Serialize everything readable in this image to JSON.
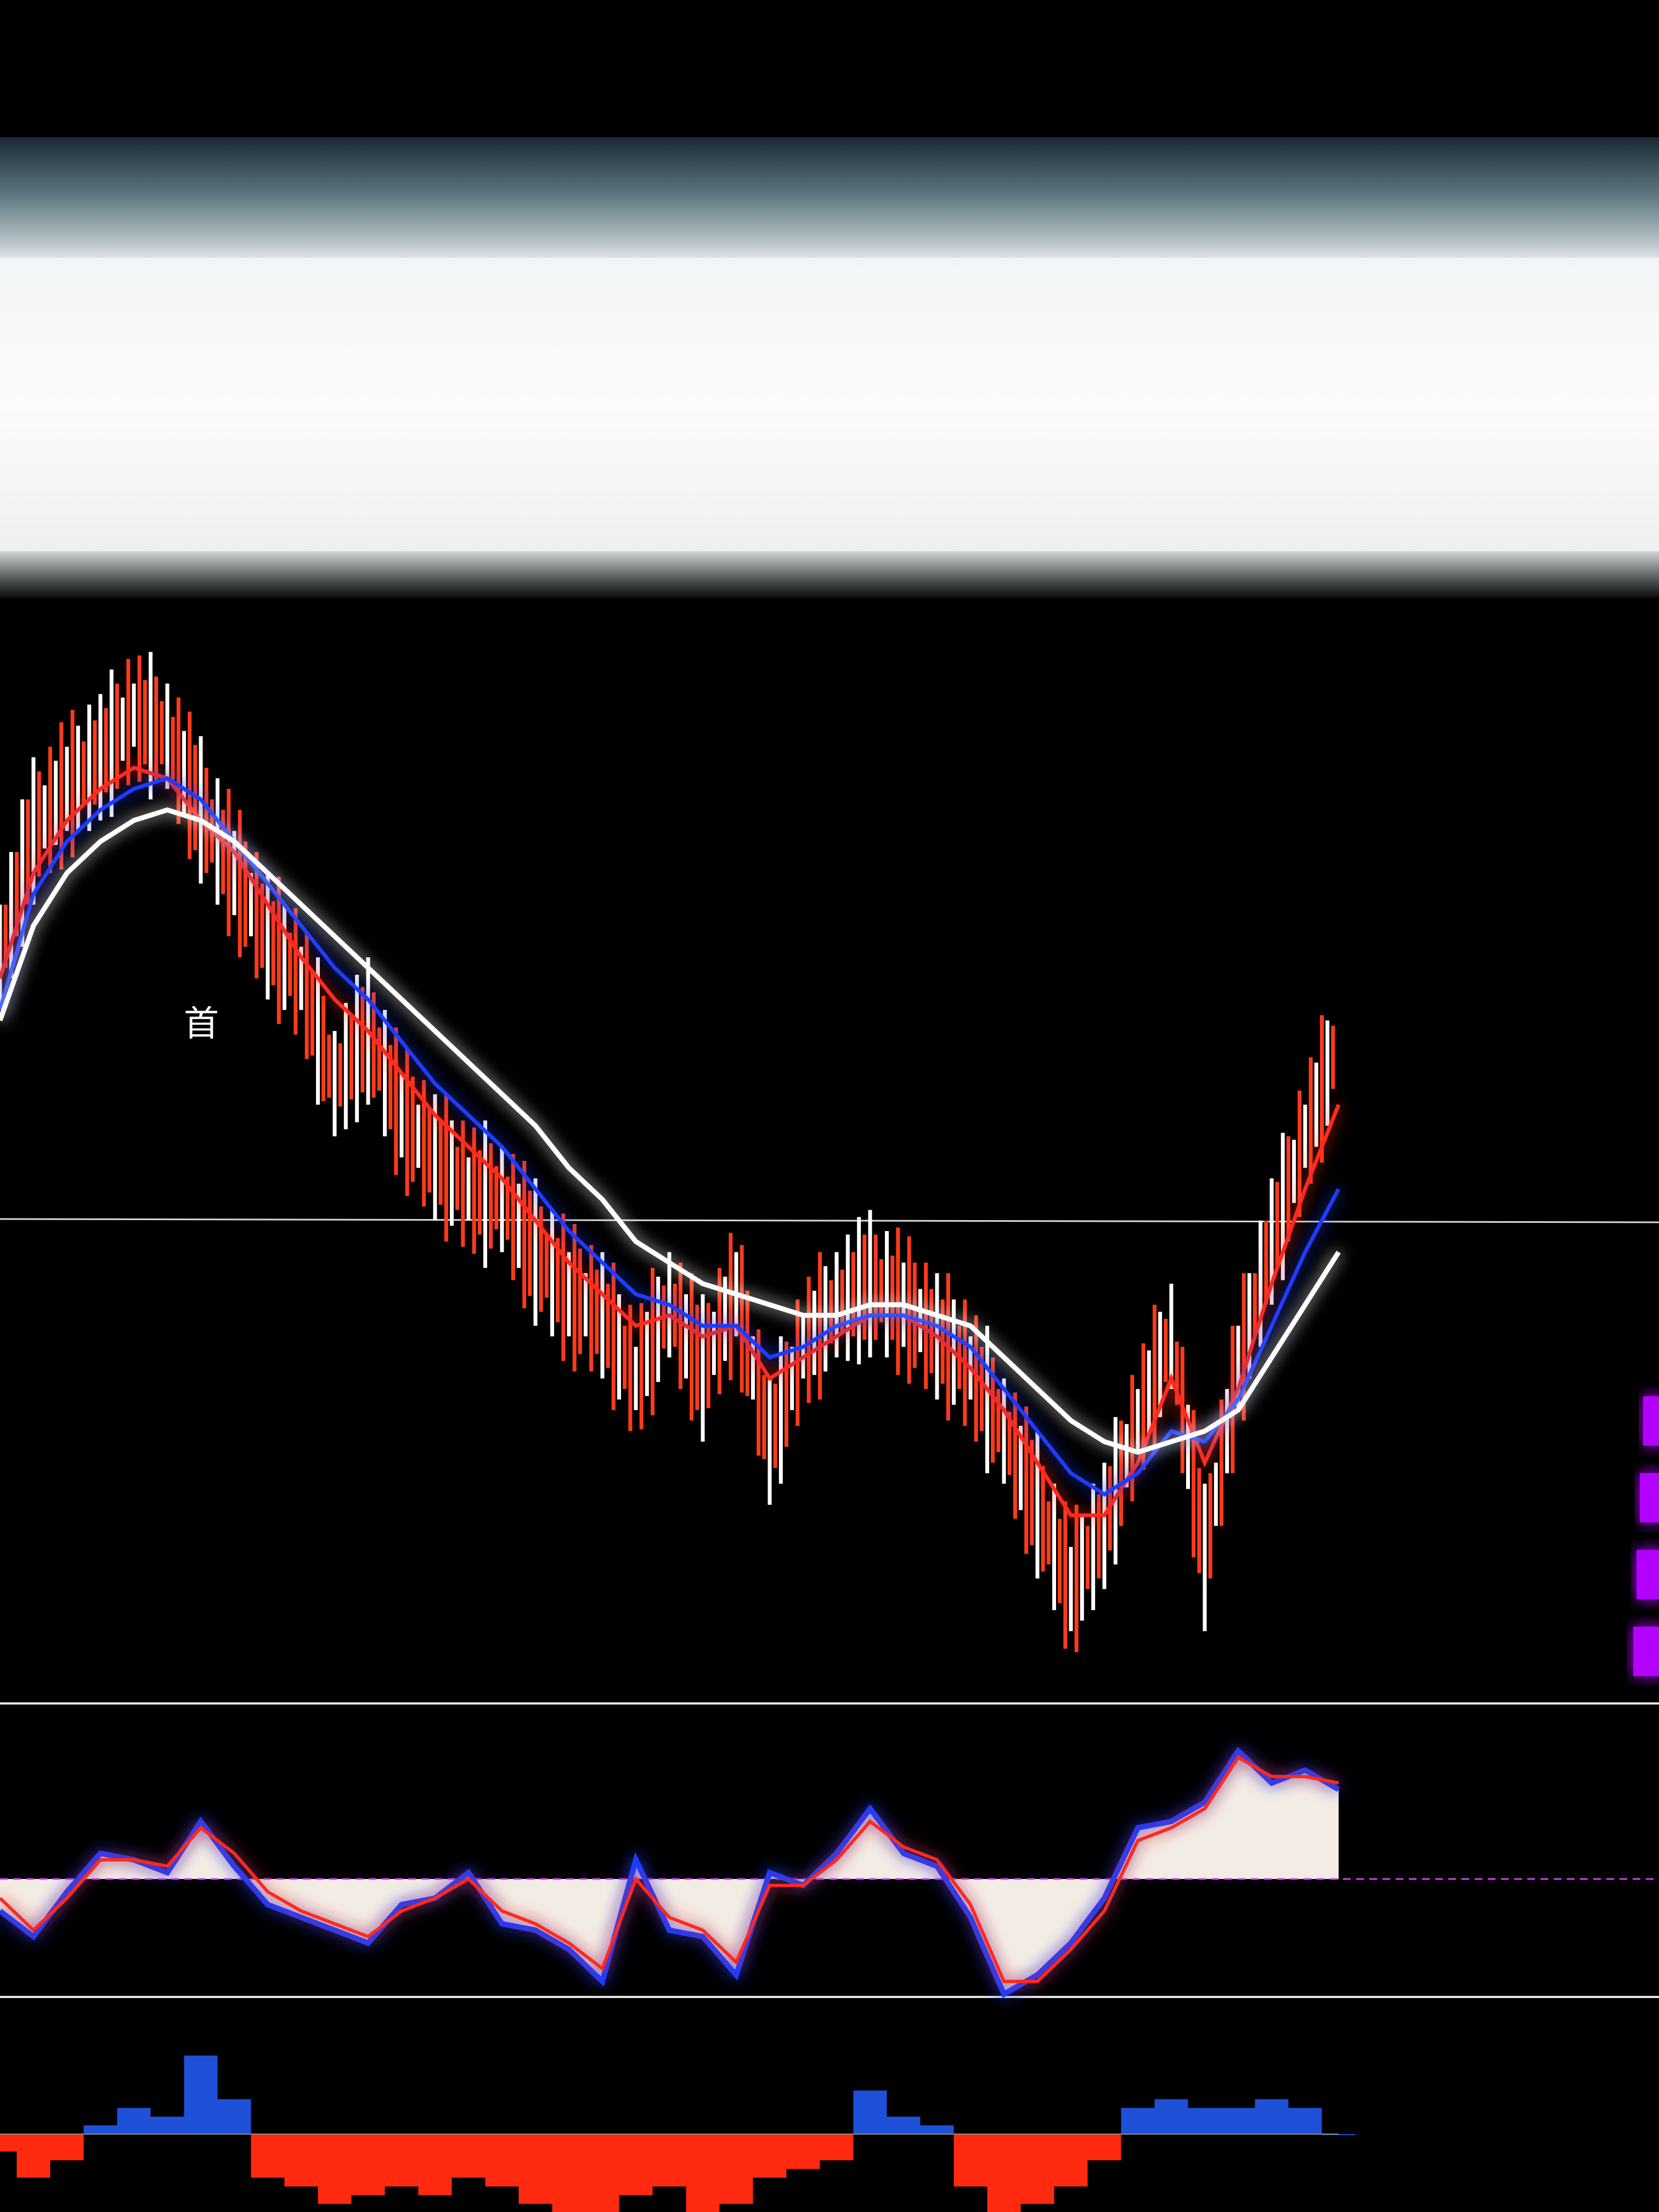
{
  "annotation_glyph": "首",
  "colors": {
    "up_bar": "#ffffff",
    "down_bar": "#ff3a1a",
    "ma_fast": "#ff2a1a",
    "ma_mid": "#1e3cff",
    "ma_slow": "#ffffff",
    "osc_fill": "#f3ece4",
    "osc_zero": "#d63cff",
    "hist_pos": "#1e50d8",
    "hist_neg": "#ff2a10",
    "side_marker": "#b400ff",
    "separator": "#e6e6e6"
  },
  "chart_data": [
    {
      "type": "line",
      "panel": "price",
      "x": [
        0,
        5,
        10,
        15,
        20,
        25,
        30,
        35,
        40,
        45,
        50,
        55,
        60,
        65,
        70,
        75,
        80,
        85,
        90,
        95,
        100,
        105,
        110,
        115,
        120,
        125,
        130,
        135,
        140,
        145,
        150,
        155,
        160,
        165,
        170,
        175,
        180,
        185,
        190,
        195,
        200
      ],
      "price": [
        50,
        62,
        66,
        69,
        73,
        71,
        64,
        58,
        52,
        48,
        38,
        43,
        35,
        31,
        28,
        27,
        22,
        18,
        16,
        10,
        17,
        11,
        18,
        4,
        13,
        17,
        19,
        17,
        14,
        11,
        5,
        -2,
        -10,
        -4,
        6,
        14,
        -7,
        11,
        23,
        33,
        42
      ],
      "series": [
        {
          "values": [
            50,
            62,
            66,
            69,
            73,
            71,
            64,
            58,
            52,
            48,
            38,
            43,
            35,
            31,
            28,
            27,
            22,
            18,
            16,
            10,
            17,
            11,
            18,
            4,
            13,
            17,
            19,
            17,
            14,
            11,
            5,
            -2,
            -10,
            -4,
            6,
            14,
            -7,
            11,
            23,
            33,
            42
          ]
        },
        {
          "values": [
            48,
            58,
            63,
            66,
            68,
            67,
            63,
            60,
            55,
            50,
            46,
            43,
            39,
            35,
            32,
            29,
            25,
            21,
            18,
            15,
            16,
            14,
            15,
            10,
            12,
            14,
            16,
            16,
            14,
            11,
            7,
            2,
            -3,
            -3,
            2,
            10,
            2,
            9,
            19,
            28,
            36
          ]
        },
        {
          "values": [
            45,
            56,
            61,
            64,
            66,
            67,
            65,
            61,
            57,
            53,
            49,
            46,
            42,
            38,
            35,
            32,
            28,
            24,
            21,
            18,
            17,
            15,
            15,
            12,
            13,
            15,
            16,
            16,
            15,
            13,
            9,
            5,
            1,
            -1,
            1,
            5,
            4,
            8,
            15,
            22,
            28
          ]
        },
        {
          "values": [
            44,
            53,
            58,
            61,
            63,
            64,
            63,
            61,
            58,
            55,
            52,
            49,
            46,
            43,
            40,
            37,
            34,
            30,
            27,
            23,
            21,
            19,
            18,
            17,
            16,
            16,
            17,
            17,
            16,
            15,
            12,
            9,
            6,
            4,
            3,
            4,
            5,
            7,
            12,
            17,
            22
          ]
        }
      ]
    },
    {
      "type": "line",
      "panel": "oscillator",
      "x": [
        0,
        5,
        10,
        15,
        20,
        25,
        30,
        35,
        40,
        45,
        50,
        55,
        60,
        65,
        70,
        75,
        80,
        85,
        90,
        95,
        100,
        105,
        110,
        115,
        120,
        125,
        130,
        135,
        140,
        145,
        150,
        155,
        160,
        165,
        170,
        175,
        180,
        185,
        190,
        195,
        200
      ],
      "series": [
        {
          "values": [
            -0.5,
            -0.9,
            -0.2,
            0.4,
            0.3,
            0.1,
            0.9,
            0.2,
            -0.4,
            -0.6,
            -0.8,
            -1.0,
            -0.4,
            -0.3,
            0.1,
            -0.7,
            -0.8,
            -1.1,
            -1.6,
            0.3,
            -0.8,
            -0.9,
            -1.5,
            0.1,
            -0.1,
            0.4,
            1.1,
            0.4,
            0.2,
            -0.6,
            -1.8,
            -1.5,
            -1.0,
            -0.3,
            0.8,
            0.9,
            1.2,
            2.0,
            1.5,
            1.7,
            1.4
          ]
        },
        {
          "values": [
            -0.3,
            -0.8,
            -0.3,
            0.3,
            0.3,
            0.2,
            0.8,
            0.4,
            -0.2,
            -0.5,
            -0.7,
            -0.9,
            -0.5,
            -0.3,
            0.0,
            -0.5,
            -0.7,
            -1.0,
            -1.4,
            0.0,
            -0.6,
            -0.8,
            -1.3,
            -0.1,
            -0.1,
            0.3,
            0.9,
            0.5,
            0.3,
            -0.4,
            -1.6,
            -1.6,
            -1.1,
            -0.5,
            0.6,
            0.8,
            1.1,
            1.9,
            1.6,
            1.6,
            1.5
          ]
        }
      ]
    },
    {
      "type": "bar",
      "panel": "histogram",
      "x": [
        0,
        5,
        10,
        15,
        20,
        25,
        30,
        35,
        40,
        45,
        50,
        55,
        60,
        65,
        70,
        75,
        80,
        85,
        90,
        95,
        100,
        105,
        110,
        115,
        120,
        125,
        130,
        135,
        140,
        145,
        150,
        155,
        160,
        165,
        170,
        175,
        180,
        185,
        190,
        195,
        200
      ],
      "values": [
        -0.2,
        -0.5,
        -0.3,
        0.1,
        0.3,
        0.2,
        0.9,
        0.4,
        -0.5,
        -0.6,
        -0.8,
        -0.7,
        -0.6,
        -0.7,
        -0.5,
        -0.6,
        -0.8,
        -1.1,
        -0.9,
        -0.7,
        -0.6,
        -0.9,
        -0.8,
        -0.5,
        -0.4,
        -0.3,
        0.5,
        0.2,
        0.1,
        -0.6,
        -1.0,
        -0.8,
        -0.6,
        -0.3,
        0.3,
        0.4,
        0.3,
        0.3,
        0.4,
        0.3,
        0.0
      ]
    }
  ]
}
